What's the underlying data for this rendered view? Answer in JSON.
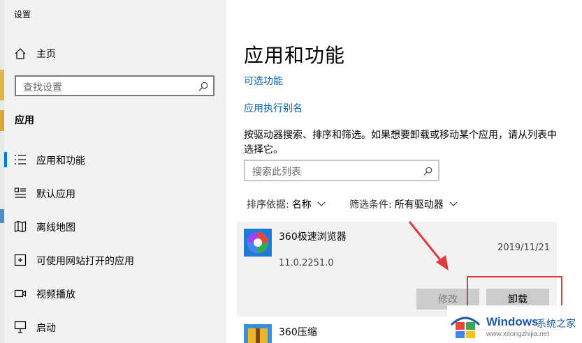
{
  "window": {
    "title": "设置"
  },
  "sidebar": {
    "home_label": "主页",
    "search_placeholder": "查找设置",
    "section_title": "应用",
    "items": [
      {
        "label": "应用和功能",
        "icon": "apps-list-icon",
        "active": true
      },
      {
        "label": "默认应用",
        "icon": "default-apps-icon",
        "active": false
      },
      {
        "label": "离线地图",
        "icon": "offline-map-icon",
        "active": false
      },
      {
        "label": "可使用网站打开的应用",
        "icon": "website-apps-icon",
        "active": false
      },
      {
        "label": "视频播放",
        "icon": "video-icon",
        "active": false
      },
      {
        "label": "启动",
        "icon": "startup-icon",
        "active": false
      }
    ]
  },
  "main": {
    "title": "应用和功能",
    "links": [
      "可选功能",
      "应用执行别名"
    ],
    "description": "按驱动器搜索、排序和筛选。如果想要卸载或移动某个应用，请从列表中选择它。",
    "list_search_placeholder": "搜索此列表",
    "sort": {
      "label": "排序依据:",
      "value": "名称"
    },
    "filter": {
      "label": "筛选条件:",
      "value": "所有驱动器"
    },
    "apps": [
      {
        "name": "360极速浏览器",
        "date": "2019/11/21",
        "version": "11.0.2251.0",
        "modify_label": "修改",
        "uninstall_label": "卸载"
      },
      {
        "name": "360压缩"
      }
    ]
  },
  "watermark": {
    "brand": "Windows",
    "site": "系统之家",
    "url": "www.xitongzhijia.net"
  },
  "colors": {
    "accent": "#0078d7",
    "link": "#0063b1",
    "highlight": "#e23a3a"
  }
}
